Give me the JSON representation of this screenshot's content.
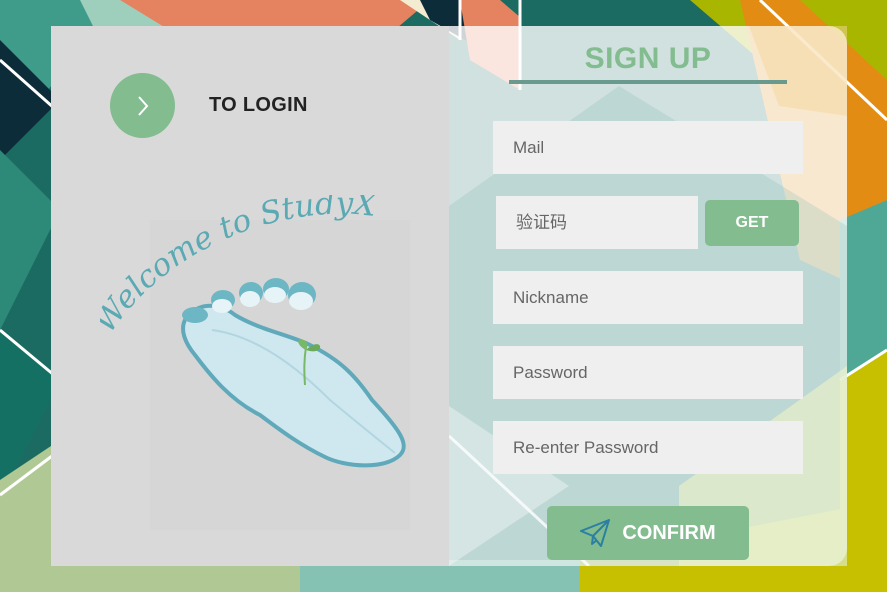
{
  "colors": {
    "accent": "#82bc8f",
    "left_panel": "#d9d9d9",
    "field_bg": "#efefef",
    "underline": "#6a9a8d"
  },
  "left": {
    "login_label": "TO LOGIN",
    "login_icon": "chevron-right-icon",
    "welcome_text": "Welcome to StudyX"
  },
  "form": {
    "title": "SIGN UP",
    "mail_placeholder": "Mail",
    "code_placeholder": "验证码",
    "get_label": "GET",
    "nickname_placeholder": "Nickname",
    "password_placeholder": "Password",
    "reenter_placeholder": "Re-enter Password",
    "confirm_label": "CONFIRM",
    "confirm_icon": "paper-plane-icon"
  }
}
